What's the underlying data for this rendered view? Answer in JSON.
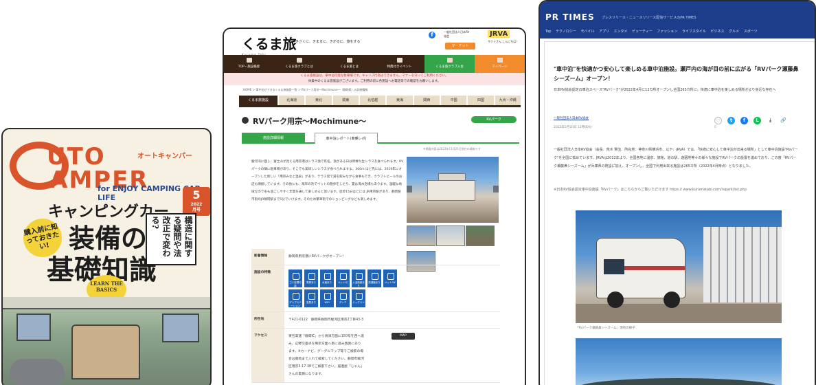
{
  "magazine": {
    "logo_line1": "UTO",
    "logo_line2": "AMPER",
    "kana": "オートキャンパー",
    "subtitle": "for ENJOY CAMPING CAR LIFE",
    "issue_month": "5",
    "issue_year": "2022",
    "issue_suffix": "月号",
    "headline": "キャンピングカー",
    "badge": "購入前に知っておきたい!",
    "title_a": "装備の",
    "title_b": "基礎知識",
    "vertical_copy": "構造に関する疑問や法改正で変わる?",
    "learn_badge": "LEARN THE BASICS"
  },
  "kurumatabi": {
    "logo": "くるま旅",
    "logo_sub": "Kuruma Tabi",
    "tagline": "きさくに、きままに、きがるに、旅をする",
    "assoc": "一般社団法人日本RV協会",
    "jrva": "JRVA",
    "jrva_sub": "サクトさん こんにちは！",
    "market_btn": "マーケット",
    "nav": [
      {
        "label": "TOP・施設検索",
        "style": ""
      },
      {
        "label": "くるま旅クラブとは",
        "style": ""
      },
      {
        "label": "くるま旅とは",
        "style": ""
      },
      {
        "label": "特典付きイベント",
        "style": ""
      },
      {
        "label": "くるま旅クラブ入会",
        "style": "green"
      },
      {
        "label": "マイページ",
        "style": "orange"
      }
    ],
    "alert_line1": "くるま旅施設は、車中泊可能な駐車場です。キャンプ行為はできません。マナーを守ってご利用ください。",
    "alert_line2": "休業中のくるま旅施設がございます。ご利用の前に各施設へお電話等での確認をお願いします。",
    "breadcrumb": "HOME ＞ 車中泊ができるくるま旅施設一覧 ＞ RVパーク用宗〜Mochimune〜（静岡県）の詳細情報",
    "region_tabs": [
      "くるま旅施設",
      "北海道",
      "東北",
      "関東",
      "北信越",
      "東海",
      "関西",
      "中国",
      "四国",
      "九州・沖縄"
    ],
    "page_title": "RVパーク用宗〜Mochimune〜",
    "rv_button": "RVパーク",
    "tab_detail": "施設詳細情報",
    "tab_report": "車中泊レポート(車乗レポ)",
    "note": "※掲載内容は2023年11月25日現在の情報です",
    "description": "駿河湾に面し、富士山が見える用宗港はシラス漁で有名。漁がある日は新鮮な生シラスを食べられます。RVパークの隣に駐車場があり、そこでも美味しいシラスが食べられますよ。300m ほど先には、2019年にオープンした新しい「用宗みなと温泉」があり、テラス席で湯を飲みながら食事もでき、クラフトビールのお店も隣接しています。その他にも、海岸の浜でペットの散歩をしたり、夏は海水浴場もあります。温暖な地域なので冬も過ごしやすく年間を通して楽しめると思います。徒歩15分ほどには JR用宗駅があり、静岡駅市街のJR静岡駅まで5分でいけます。そのため繁華街でのショッピングなども楽しめます。",
    "rows": [
      {
        "key": "新着情報",
        "value": "静岡県用宗港にRVパークがオープン！"
      },
      {
        "key": "施設の特徴",
        "value": ""
      },
      {
        "key": "所在地",
        "value": "〒421-0122　静岡県静岡市駿河区用宗2丁目43-3"
      },
      {
        "key": "アクセス",
        "value": "東名高速「静岡IC」から焼津方面に150号を西へ進み、広野交差点を用宗方面へ南に進み西側にあります。※カーナビ、グーグルマップ等でご検索の場合は番地まで入れて検索してください。静岡市駿河区用宗3-17-38でご検索下さい。居酒屋「じゃん」さんの裏側になります。"
      }
    ],
    "features": [
      "ゴミ処理可能",
      "電源あり",
      "水道あり",
      "ペット可",
      "入浴施設あり",
      "洗濯機あり",
      "ペットOK",
      "ダンプステーション",
      "温泉あり",
      "WiFi",
      "ダンプ",
      "ドッグラン"
    ],
    "map_btn": "MAP"
  },
  "prtimes": {
    "logo": "PR TIMES",
    "tagline": "プレスリリース・ニュースリリース配信サービスのPR TIMES",
    "nav": [
      "Top",
      "テクノロジー",
      "モバイル",
      "アプリ",
      "エンタメ",
      "ビューティー",
      "ファッション",
      "ライフスタイル",
      "ビジネス",
      "グルメ",
      "スポーツ"
    ],
    "title": "\"車中泊\"を快適かつ安心して楽しめる車中泊施設。瀬戸内の海が目の前に広がる「RVパーク瀬藤鼻シーズーム」オープン！",
    "lead": "日本RV協会認定の車泊スペース\"RVパーク\"が2022年4月に12カ所オープンし全国265カ所に。快適に車中泊を楽しめる場所がより身近な存在へ",
    "org": "一般社団法人日本RV協会",
    "date": "2022年5月20日 12時00分",
    "counts": "0",
    "body": "一般社団法人日本RV協会（会長：荒木 賢治、所在地：神奈川県横浜市、以下：JRVA）では、「快適に安心して車中泊が出来る場所」として車中泊施設\"RVパーク\"を全国に拡めています。JRVAは2012年より、全国各地に温泉、旅館、道の駅、遊園地等々の様々な施設でRVパークの設置を進めており、この度「RVパーク瀬藤鼻シーズーム」が兵庫県の既設に加え、オープンし、全国で利用出来る施設は265カ所（2022年4月時点）となりました。",
    "link": "※日本RV協会認定車中泊施設「RVパーク」はこちらからご覧いただけます https:// www.kurumatabi.com/rvpark/list.php",
    "caption": "「RVパーク瀬藤鼻シーズーム」現地の様子"
  }
}
